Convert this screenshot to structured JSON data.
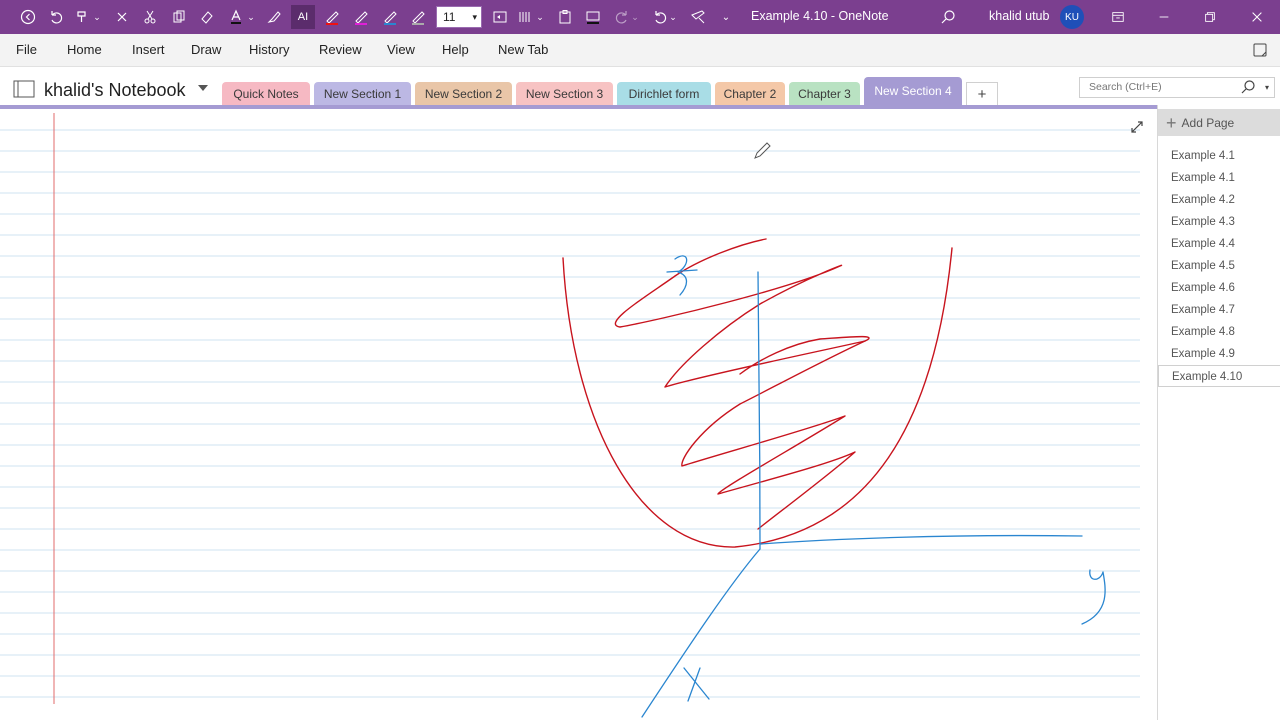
{
  "app": {
    "window_title": "Example 4.10  -  OneNote",
    "user_name": "khalid utub",
    "user_initials": "KU",
    "font_size_value": "11"
  },
  "menu": [
    "File",
    "Home",
    "Insert",
    "Draw",
    "History",
    "Review",
    "View",
    "Help",
    "New Tab"
  ],
  "notebook": {
    "name": "khalid's Notebook"
  },
  "sections": [
    {
      "label": "Quick Notes",
      "color": "#f6b9c3"
    },
    {
      "label": "New Section 1",
      "color": "#bcb8e4"
    },
    {
      "label": "New Section 2",
      "color": "#e9c6a8"
    },
    {
      "label": "New Section 3",
      "color": "#f7c3c3"
    },
    {
      "label": "Dirichlet form",
      "color": "#a9dde6"
    },
    {
      "label": "Chapter 2",
      "color": "#f4c8a8"
    },
    {
      "label": "Chapter 3",
      "color": "#b9e2c2"
    },
    {
      "label": "New Section 4",
      "color": "#a59bd3",
      "active": true
    }
  ],
  "add_section_label": "+",
  "search": {
    "placeholder": "Search (Ctrl+E)"
  },
  "pages": {
    "add_label": "Add Page",
    "items": [
      "Example 4.1",
      "Example 4.1",
      "Example 4.2",
      "Example 4.3",
      "Example 4.4",
      "Example 4.5",
      "Example 4.6",
      "Example 4.7",
      "Example 4.8",
      "Example 4.9",
      "Example 4.10"
    ],
    "active_index": 10
  },
  "ink_labels": {
    "z": "z",
    "x": "X",
    "y": "y"
  },
  "colors": {
    "title_bar": "#7b3f8f",
    "ink_red": "#c8141e",
    "ink_blue": "#2a86d0",
    "rule_line": "#cfe3f2",
    "margin_line": "#e06b6b"
  }
}
